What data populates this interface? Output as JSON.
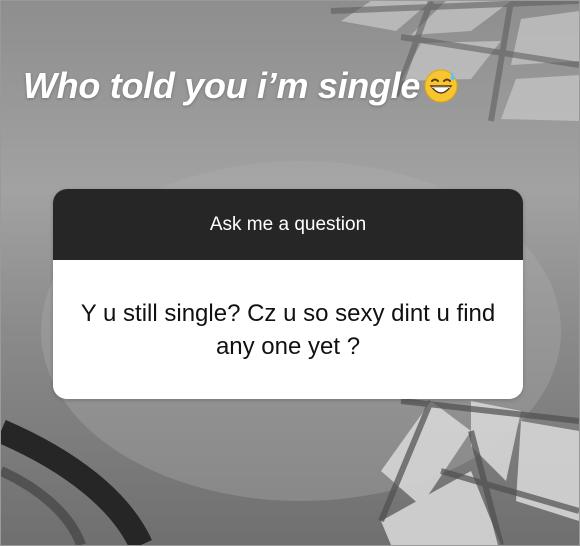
{
  "story": {
    "caption": "Who told you i’m single",
    "caption_emoji": "grinning-face-with-sweat-emoji"
  },
  "question_sticker": {
    "header": "Ask me a question",
    "answer": "Y u still single? Cz u so sexy dint u find any one yet ?"
  },
  "colors": {
    "background": "#9a9a9a",
    "header_bg": "#262626",
    "card_bg": "#ffffff",
    "caption_text": "#ffffff",
    "answer_text": "#111111"
  }
}
